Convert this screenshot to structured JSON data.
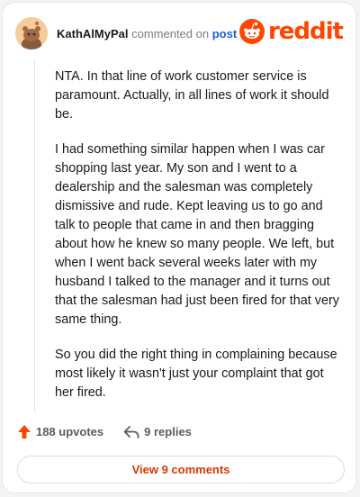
{
  "header": {
    "username": "KathAlMyPal",
    "action_text": "commented on",
    "post_link": "post",
    "logo_text": "reddit"
  },
  "comment": {
    "paragraphs": [
      "NTA. In that line of work customer service is paramount. Actually, in all lines of work it should be.",
      "I had something similar happen when I was car shopping last year. My son and I went to a dealership and the salesman was completely dismissive and rude. Kept leaving us to go and talk to people that came in and then bragging about how he knew so many people. We left, but when I went back several weeks later with my husband I talked to the manager and it turns out that the salesman had just been fired for that very same thing.",
      "So you did the right thing in complaining because most likely it wasn't just your complaint that got her fired."
    ]
  },
  "actions": {
    "upvotes_label": "188 upvotes",
    "replies_label": "9 replies"
  },
  "footer": {
    "view_comments_label": "View 9 comments"
  },
  "colors": {
    "brand": "#ff4500",
    "link": "#1d5fd1",
    "view_button_text": "#d93a00"
  },
  "icons": {
    "avatar": "snoo-avatar-icon",
    "logo": "reddit-snoo-icon",
    "upvote": "upvote-arrow-icon",
    "reply": "reply-arrow-icon"
  }
}
